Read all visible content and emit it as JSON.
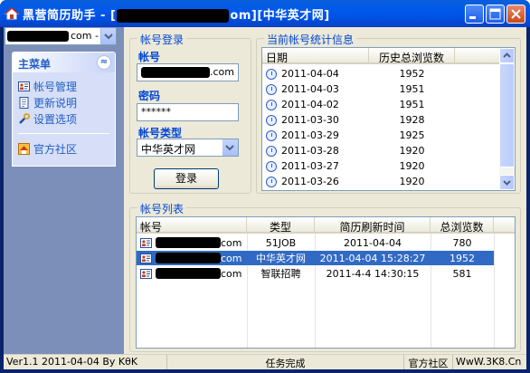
{
  "window": {
    "title_prefix": "黑营简历助手 - [",
    "title_email_suffix": "om]",
    "title_site": "[中华英才网]"
  },
  "sidebar": {
    "account_suffix": "com -",
    "panel_title": "主菜单",
    "collapse_glyph": "≈",
    "items": [
      {
        "label": "帐号管理",
        "icon": "account-card-icon"
      },
      {
        "label": "更新说明",
        "icon": "document-icon"
      },
      {
        "label": "设置选项",
        "icon": "wrench-icon"
      }
    ],
    "community": {
      "label": "官方社区",
      "icon": "community-icon"
    }
  },
  "login": {
    "group_title": "帐号登录",
    "account_label": "帐号",
    "account_suffix": ".com",
    "password_label": "密码",
    "password_value": "******",
    "type_label": "帐号类型",
    "type_value": "中华英才网",
    "login_button": "登录"
  },
  "stats": {
    "group_title": "当前帐号统计信息",
    "columns": [
      "日期",
      "历史总浏览数"
    ],
    "rows": [
      {
        "date": "2011-04-04",
        "views": "1952"
      },
      {
        "date": "2011-04-03",
        "views": "1951"
      },
      {
        "date": "2011-04-02",
        "views": "1951"
      },
      {
        "date": "2011-03-30",
        "views": "1928"
      },
      {
        "date": "2011-03-29",
        "views": "1925"
      },
      {
        "date": "2011-03-28",
        "views": "1920"
      },
      {
        "date": "2011-03-27",
        "views": "1920"
      },
      {
        "date": "2011-03-26",
        "views": "1920"
      }
    ]
  },
  "accounts": {
    "group_title": "帐号列表",
    "columns": [
      "帐号",
      "类型",
      "简历刷新时间",
      "总浏览数"
    ],
    "rows": [
      {
        "suffix": "com",
        "type": "51JOB",
        "time": "2011-04-04",
        "views": "780",
        "selected": false
      },
      {
        "suffix": "com",
        "type": "中华英才网",
        "time": "2011-04-04 15:28:27",
        "views": "1952",
        "selected": true
      },
      {
        "suffix": "com",
        "type": "智联招聘",
        "time": "2011-4-4 14:30:15",
        "views": "581",
        "selected": false
      }
    ]
  },
  "status": {
    "version": "Ver1.1 2011-04-04 By KθK",
    "state": "任务完成",
    "community": "官方社区",
    "website": "WwW.3K8.Cn"
  },
  "colors": {
    "titlebar": "#0054e3",
    "selection": "#316ac5",
    "link": "#215dc6",
    "group_title": "#0046d5"
  }
}
